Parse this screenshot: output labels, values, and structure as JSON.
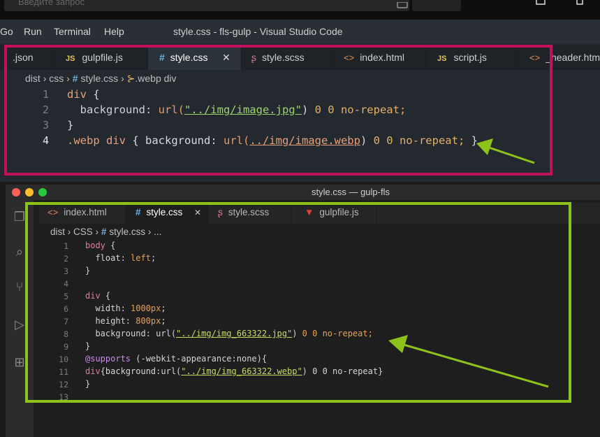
{
  "search": {
    "placeholder": "Введите запрос"
  },
  "menu": [
    "Go",
    "Run",
    "Terminal",
    "Help"
  ],
  "window1": {
    "title": "style.css - fls-gulp - Visual Studio Code",
    "tabs": [
      {
        "label": ".json",
        "icon": ""
      },
      {
        "label": "gulpfile.js",
        "icon": "JS"
      },
      {
        "label": "style.css",
        "icon": "#",
        "close": "✕"
      },
      {
        "label": "style.scss",
        "icon": "scss-icon"
      },
      {
        "label": "index.html",
        "icon": "<>"
      },
      {
        "label": "script.js",
        "icon": "JS"
      },
      {
        "label": "_header.html",
        "icon": "<>"
      }
    ],
    "breadcrumb": {
      "p1": "dist",
      "p2": "css",
      "p3": "style.css",
      "p4": ".webp div"
    },
    "line_numbers": [
      "1",
      "2",
      "3",
      "4"
    ],
    "code": {
      "l1_sel": "div",
      "l1_brace": " {",
      "l2_prop": "  background: ",
      "l2_fn": "url(",
      "l2_str": "\"../img/image.jpg\"",
      "l2_rest": ") ",
      "l2_nums": "0 0",
      "l2_kw": " no-repeat;",
      "l3": "}",
      "l4_sel": ".webp div",
      "l4_a": " { background: ",
      "l4_fn": "url(",
      "l4_str": "../img/image.webp",
      "l4_b": ") ",
      "l4_nums": "0 0",
      "l4_kw": " no-repeat;",
      "l4_c": " }"
    }
  },
  "window2": {
    "title": "style.css — gulp-fls",
    "tabs": [
      {
        "label": "index.html",
        "icon": "<>"
      },
      {
        "label": "style.css",
        "icon": "#",
        "close": "✕"
      },
      {
        "label": "style.scss",
        "icon": "scss-icon"
      },
      {
        "label": "gulpfile.js",
        "icon": "gulp-icon"
      }
    ],
    "breadcrumb": {
      "p1": "dist",
      "p2": "CSS",
      "p3": "style.css",
      "p4": "..."
    },
    "line_numbers": [
      "1",
      "2",
      "3",
      "4",
      "5",
      "6",
      "7",
      "8",
      "9",
      "10",
      "11",
      "12",
      "13"
    ],
    "code": {
      "l1_sel": "body",
      "l1_b": " {",
      "l2_p": "  float: ",
      "l2_v": "left",
      "l2_e": ";",
      "l3": "}",
      "l5_sel": "div",
      "l5_b": " {",
      "l6_p": "  width: ",
      "l6_v": "1000px",
      "l6_e": ";",
      "l7_p": "  height: ",
      "l7_v": "800px",
      "l7_e": ";",
      "l8_p": "  background: url(",
      "l8_s": "\"../img/img_663322.jpg\"",
      "l8_r": ") ",
      "l8_n": "0 0",
      "l8_k": " no-repeat;",
      "l9": "}",
      "l10_at": "@supports",
      "l10_r": " (-webkit-appearance:none){",
      "l11_sel": "div",
      "l11_a": "{background:url(",
      "l11_s": "\"../img/img_663322.webp\"",
      "l11_b": ") 0 0 no-repeat}",
      "l12": "}"
    }
  },
  "colors": {
    "frame_top": "#c2105b",
    "frame_bottom": "#8ec21b",
    "arrow": "#8ec21b"
  }
}
